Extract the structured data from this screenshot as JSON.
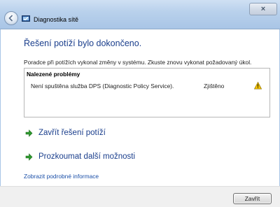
{
  "window": {
    "title": "Diagnostika sítě",
    "close_glyph": "×"
  },
  "main": {
    "heading": "Řešení potíží bylo dokončeno.",
    "description": "Poradce při potížích vykonal změny v systému. Zkuste znovu vykonat požadovaný úkol.",
    "problems": {
      "header": "Nalezené problémy",
      "rows": [
        {
          "description": "Není spuštěna služba DPS (Diagnostic Policy Service).",
          "status": "Zjištěno",
          "icon": "warning-icon"
        }
      ]
    },
    "commands": [
      {
        "label": "Zavřít řešení potíží",
        "icon": "green-arrow-icon"
      },
      {
        "label": "Prozkoumat další možnosti",
        "icon": "green-arrow-icon"
      }
    ],
    "details_link": "Zobrazit podrobné informace"
  },
  "footer": {
    "close_label": "Zavřít"
  },
  "colors": {
    "heading": "#1a3e8c",
    "link": "#1a4fa8",
    "arrow": "#2e9a2e",
    "warning": "#f2c200"
  }
}
